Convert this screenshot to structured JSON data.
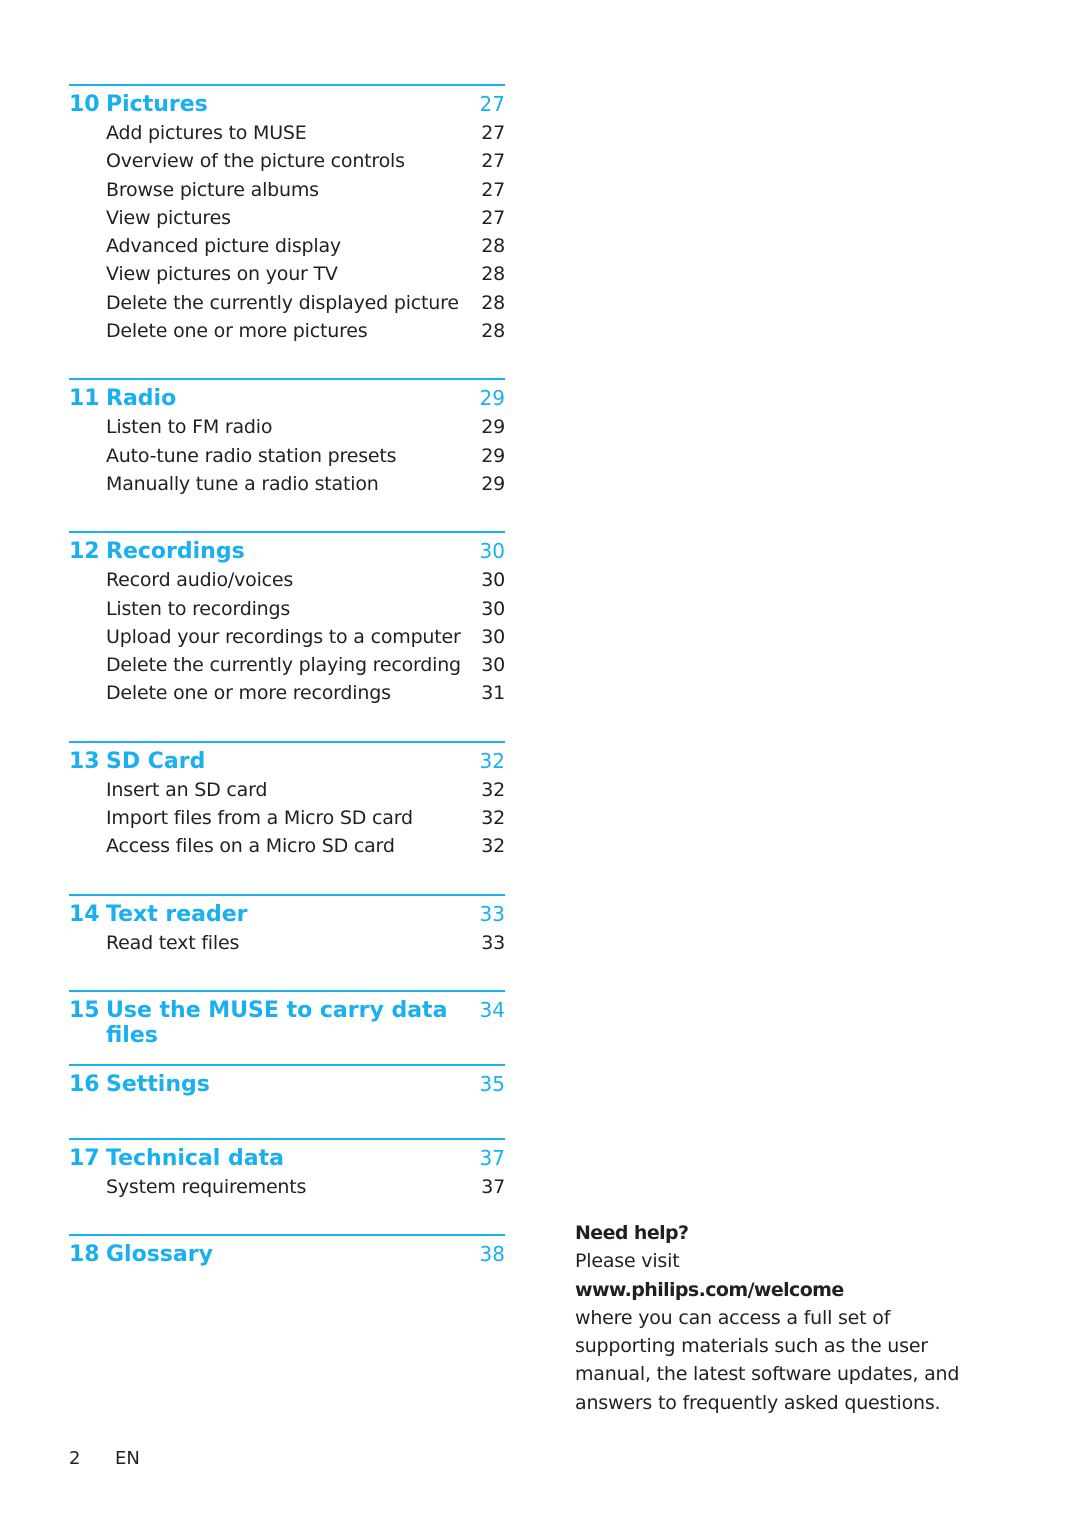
{
  "toc": {
    "accent_color": "#1ab0f0",
    "sections": [
      {
        "number": "10",
        "title": "Pictures",
        "page": "27",
        "entries": [
          {
            "title": "Add pictures to MUSE",
            "page": "27"
          },
          {
            "title": "Overview of the picture controls",
            "page": "27"
          },
          {
            "title": "Browse picture albums",
            "page": "27"
          },
          {
            "title": "View pictures",
            "page": "27"
          },
          {
            "title": "Advanced picture display",
            "page": "28"
          },
          {
            "title": "View pictures on your TV",
            "page": "28"
          },
          {
            "title": "Delete the currently displayed picture",
            "page": "28"
          },
          {
            "title": "Delete one or more pictures",
            "page": "28"
          }
        ]
      },
      {
        "number": "11",
        "title": "Radio",
        "page": "29",
        "entries": [
          {
            "title": "Listen to FM radio",
            "page": "29"
          },
          {
            "title": "Auto-tune radio station presets",
            "page": "29"
          },
          {
            "title": "Manually tune a radio station",
            "page": "29"
          }
        ]
      },
      {
        "number": "12",
        "title": "Recordings",
        "page": "30",
        "entries": [
          {
            "title": "Record audio/voices",
            "page": "30"
          },
          {
            "title": "Listen to recordings",
            "page": "30"
          },
          {
            "title": "Upload your recordings to a computer",
            "page": "30"
          },
          {
            "title": "Delete the currently playing recording",
            "page": "30"
          },
          {
            "title": "Delete one or more recordings",
            "page": "31"
          }
        ]
      },
      {
        "number": "13",
        "title": "SD Card",
        "page": "32",
        "entries": [
          {
            "title": "Insert an SD card",
            "page": "32"
          },
          {
            "title": "Import files from a Micro SD card",
            "page": "32"
          },
          {
            "title": "Access files on a Micro SD card",
            "page": "32"
          }
        ]
      },
      {
        "number": "14",
        "title": "Text reader",
        "page": "33",
        "entries": [
          {
            "title": "Read text files",
            "page": "33"
          }
        ]
      },
      {
        "number": "15",
        "title": "Use the MUSE to carry data files",
        "page": "34",
        "entries": []
      },
      {
        "number": "16",
        "title": "Settings",
        "page": "35",
        "entries": []
      },
      {
        "number": "17",
        "title": "Technical data",
        "page": "37",
        "entries": [
          {
            "title": "System requirements",
            "page": "37"
          }
        ]
      },
      {
        "number": "18",
        "title": "Glossary",
        "page": "38",
        "entries": []
      }
    ]
  },
  "help": {
    "heading": "Need help?",
    "line1": "Please visit",
    "url": "www.philips.com/welcome",
    "body": "where you can access a full set of supporting materials such as the user manual, the latest software updates, and answers to frequently asked questions."
  },
  "footer": {
    "page_number": "2",
    "language": "EN"
  }
}
